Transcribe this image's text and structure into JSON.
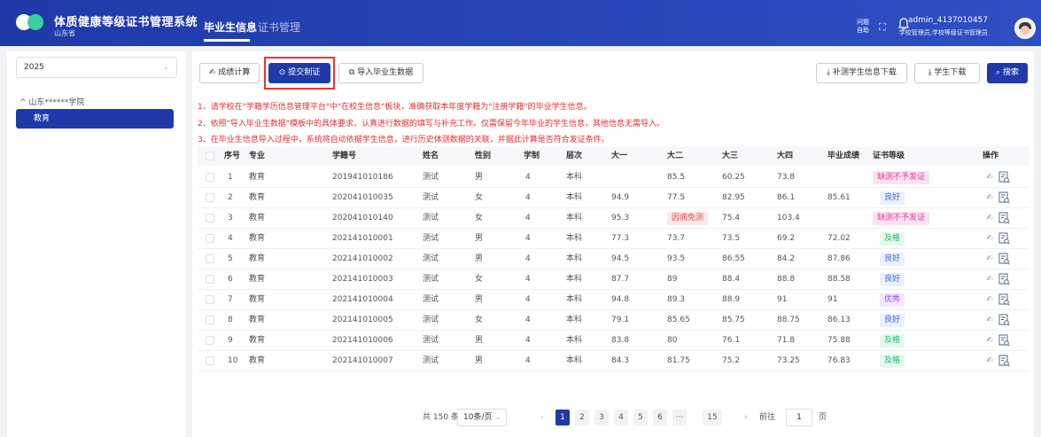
{
  "header": {
    "title": "体质健康等级证书管理系统",
    "subtitle": "山东省",
    "tabs": [
      "毕业生信息",
      "证书管理"
    ],
    "help_label_1": "问题",
    "help_label_2": "自助",
    "user_name": "admin_4137010457",
    "user_role": "学校管理员,学校等级证书管理员",
    "brand_color": "#2440b3"
  },
  "sidebar": {
    "year": "2025",
    "tree_parent": "山东******学院",
    "tree_child": "教育"
  },
  "toolbar": {
    "calc_label": "成绩计算",
    "submit_label": "提交制证",
    "import_label": "导入毕业生数据",
    "supp_download_label": "补测学生信息下载",
    "student_download_label": "学生下载",
    "search_label": "搜索"
  },
  "notices": [
    "1、请学校在\"学籍学历信息管理平台\"中\"在校生信息\"板块，准确获取本年度学籍为\"注册学籍\"的毕业学生信息。",
    "2、依照\"导入毕业生数据\"模板中的具体要求，认真进行数据的填写与补充工作。仅需保留今年毕业的学生信息，其他信息无需导入。",
    "3、在毕业生信息导入过程中，系统将自动依据学生信息，进行历史体测数据的关联，并据此计算是否符合发证条件。"
  ],
  "table": {
    "columns": [
      "序号",
      "专业",
      "学籍号",
      "姓名",
      "性别",
      "学制",
      "层次",
      "大一",
      "大二",
      "大三",
      "大四",
      "毕业成绩",
      "证书等级",
      "操作"
    ],
    "rows": [
      {
        "no": "1",
        "major": "教育",
        "id": "201941010186",
        "name": "测试",
        "gender": "男",
        "years": "4",
        "level": "本科",
        "y1": "",
        "y2": "85.5",
        "y3": "60.25",
        "y4": "73.8",
        "grad": "",
        "cert": "缺测不予发证",
        "cert_type": "red"
      },
      {
        "no": "2",
        "major": "教育",
        "id": "202041010035",
        "name": "测试",
        "gender": "女",
        "years": "4",
        "level": "本科",
        "y1": "94.9",
        "y2": "77.5",
        "y3": "82.95",
        "y4": "86.1",
        "grad": "85.61",
        "cert": "良好",
        "cert_type": "blue"
      },
      {
        "no": "3",
        "major": "教育",
        "id": "202041010140",
        "name": "测试",
        "gender": "女",
        "years": "4",
        "level": "本科",
        "y1": "95.3",
        "y2": "因病免测",
        "y3": "75.4",
        "y4": "103.4",
        "grad": "",
        "cert": "缺测不予发证",
        "cert_type": "red",
        "y2_tag": true
      },
      {
        "no": "4",
        "major": "教育",
        "id": "202141010001",
        "name": "测试",
        "gender": "男",
        "years": "4",
        "level": "本科",
        "y1": "77.3",
        "y2": "73.7",
        "y3": "73.5",
        "y4": "69.2",
        "grad": "72.02",
        "cert": "及格",
        "cert_type": "green"
      },
      {
        "no": "5",
        "major": "教育",
        "id": "202141010002",
        "name": "测试",
        "gender": "男",
        "years": "4",
        "level": "本科",
        "y1": "94.5",
        "y2": "93.5",
        "y3": "86.55",
        "y4": "84.2",
        "grad": "87.86",
        "cert": "良好",
        "cert_type": "blue"
      },
      {
        "no": "6",
        "major": "教育",
        "id": "202141010003",
        "name": "测试",
        "gender": "女",
        "years": "4",
        "level": "本科",
        "y1": "87.7",
        "y2": "89",
        "y3": "88.4",
        "y4": "88.8",
        "grad": "88.58",
        "cert": "良好",
        "cert_type": "blue"
      },
      {
        "no": "7",
        "major": "教育",
        "id": "202141010004",
        "name": "测试",
        "gender": "男",
        "years": "4",
        "level": "本科",
        "y1": "94.8",
        "y2": "89.3",
        "y3": "88.9",
        "y4": "91",
        "grad": "91",
        "cert": "优秀",
        "cert_type": "purple"
      },
      {
        "no": "8",
        "major": "教育",
        "id": "202141010005",
        "name": "测试",
        "gender": "女",
        "years": "4",
        "level": "本科",
        "y1": "79.1",
        "y2": "85.65",
        "y3": "85.75",
        "y4": "88.75",
        "grad": "86.13",
        "cert": "良好",
        "cert_type": "blue"
      },
      {
        "no": "9",
        "major": "教育",
        "id": "202141010006",
        "name": "测试",
        "gender": "男",
        "years": "4",
        "level": "本科",
        "y1": "83.8",
        "y2": "80",
        "y3": "76.1",
        "y4": "71.8",
        "grad": "75.88",
        "cert": "及格",
        "cert_type": "green"
      },
      {
        "no": "10",
        "major": "教育",
        "id": "202141010007",
        "name": "测试",
        "gender": "男",
        "years": "4",
        "level": "本科",
        "y1": "84.3",
        "y2": "81.75",
        "y3": "75.2",
        "y4": "73.25",
        "grad": "76.83",
        "cert": "及格",
        "cert_type": "green"
      }
    ]
  },
  "pagination": {
    "total": "共 150 条",
    "page_size": "10条/页",
    "pages": [
      "1",
      "2",
      "3",
      "4",
      "5",
      "6",
      "···",
      "15"
    ],
    "current": "1",
    "goto_label": "前往",
    "goto_value": "1",
    "page_unit": "页"
  }
}
